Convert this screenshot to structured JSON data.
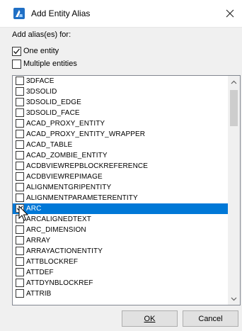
{
  "window": {
    "title": "Add Entity Alias"
  },
  "form": {
    "label": "Add alias(es) for:",
    "one_entity": {
      "label": "One entity",
      "checked": true
    },
    "multiple_entities": {
      "label": "Multiple entities",
      "checked": false
    }
  },
  "entities": [
    {
      "name": "3DFACE",
      "checked": false,
      "selected": false
    },
    {
      "name": "3DSOLID",
      "checked": false,
      "selected": false
    },
    {
      "name": "3DSOLID_EDGE",
      "checked": false,
      "selected": false
    },
    {
      "name": "3DSOLID_FACE",
      "checked": false,
      "selected": false
    },
    {
      "name": "ACAD_PROXY_ENTITY",
      "checked": false,
      "selected": false
    },
    {
      "name": "ACAD_PROXY_ENTITY_WRAPPER",
      "checked": false,
      "selected": false
    },
    {
      "name": "ACAD_TABLE",
      "checked": false,
      "selected": false
    },
    {
      "name": "ACAD_ZOMBIE_ENTITY",
      "checked": false,
      "selected": false
    },
    {
      "name": "ACDBVIEWREPBLOCKREFERENCE",
      "checked": false,
      "selected": false
    },
    {
      "name": "ACDBVIEWREPIMAGE",
      "checked": false,
      "selected": false
    },
    {
      "name": "ALIGNMENTGRIPENTITY",
      "checked": false,
      "selected": false
    },
    {
      "name": "ALIGNMENTPARAMETERENTITY",
      "checked": false,
      "selected": false
    },
    {
      "name": "ARC",
      "checked": true,
      "selected": true
    },
    {
      "name": "ARCALIGNEDTEXT",
      "checked": false,
      "selected": false
    },
    {
      "name": "ARC_DIMENSION",
      "checked": false,
      "selected": false
    },
    {
      "name": "ARRAY",
      "checked": false,
      "selected": false
    },
    {
      "name": "ARRAYACTIONENTITY",
      "checked": false,
      "selected": false
    },
    {
      "name": "ATTBLOCKREF",
      "checked": false,
      "selected": false
    },
    {
      "name": "ATTDEF",
      "checked": false,
      "selected": false
    },
    {
      "name": "ATTDYNBLOCKREF",
      "checked": false,
      "selected": false
    },
    {
      "name": "ATTRIB",
      "checked": false,
      "selected": false
    }
  ],
  "buttons": {
    "ok": "OK",
    "cancel": "Cancel"
  },
  "colors": {
    "selection": "#0078d7",
    "icon": "#1f6fc5"
  }
}
